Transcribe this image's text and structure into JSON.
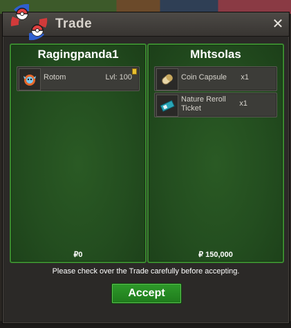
{
  "window": {
    "title": "Trade",
    "close_label": "✕"
  },
  "left_panel": {
    "player_name": "Ragingpanda1",
    "items": [
      {
        "name": "Rotom",
        "level": "Lvl: 100",
        "icon": "rotom-icon"
      }
    ],
    "money": "₽0"
  },
  "right_panel": {
    "player_name": "Mhtsolas",
    "items": [
      {
        "name": "Coin Capsule",
        "quantity": "x1",
        "icon": "coin-capsule-icon"
      },
      {
        "name": "Nature Reroll Ticket",
        "quantity": "x1",
        "icon": "ticket-icon"
      }
    ],
    "money": "₽ 150,000"
  },
  "notice": "Please check over the Trade carefully before accepting.",
  "accept_label": "Accept",
  "colors": {
    "panel_border": "#3a8a2f",
    "accept_button": "#2e9a2a"
  }
}
